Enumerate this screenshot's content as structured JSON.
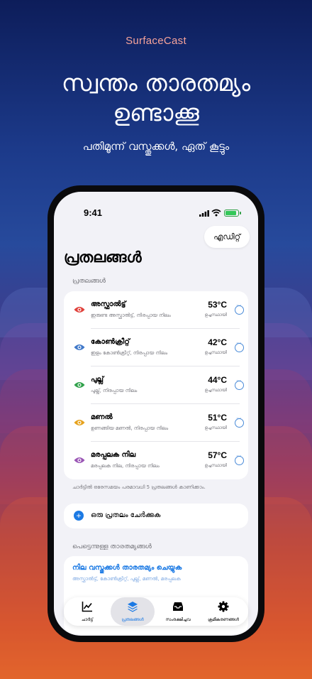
{
  "brand": "SurfaceCast",
  "headline": [
    "സ്വന്തം താരതമ്യം",
    "ഉണ്ടാക്കൂ"
  ],
  "subline": "പതിമൂന്ന് വസ്തുക്കൾ, ഏത് കൂട്ടും",
  "status_bar": {
    "time": "9:41",
    "battery_color": "#34c759"
  },
  "edit_label": "എഡിറ്റ്",
  "page_title": "പ്രതലങ്ങൾ",
  "surfaces_section_label": "പ്രതലങ്ങൾ",
  "surfaces": [
    {
      "name": "അസ്ഫാൽട്ട്",
      "desc": "ഇരുണ്ട അസ്ഫാൽട്ട്, നിരപ്പായ നിലം",
      "temp": "53°C",
      "state": "ഉച്ചസ്ഥായി",
      "color": "#e0403a"
    },
    {
      "name": "കോൺക്രീറ്റ്",
      "desc": "ഇളം കോൺക്രീറ്റ്, നിരപ്പായ നിലം",
      "temp": "42°C",
      "state": "ഉച്ചസ്ഥായി",
      "color": "#3f78c9"
    },
    {
      "name": "പുല്ല്",
      "desc": "പുല്ല്, നിരപ്പായ നിലം",
      "temp": "44°C",
      "state": "ഉച്ചസ്ഥായി",
      "color": "#2fa14a"
    },
    {
      "name": "മണൽ",
      "desc": "ഉണങ്ങിയ മണൽ, നിരപ്പായ നിലം",
      "temp": "51°C",
      "state": "ഉച്ചസ്ഥായി",
      "color": "#e6a21c"
    },
    {
      "name": "മരപ്പലക നില",
      "desc": "മരപ്പലക നില, നിരപ്പായ നിലം",
      "temp": "57°C",
      "state": "ഉച്ചസ്ഥായി",
      "color": "#9a55b5"
    }
  ],
  "chart_note": "ചാർട്ടിൽ ഒരേസമയം പരമാവധി 5 പ്രതലങ്ങൾ കാണിക്കാം.",
  "add_surface_label": "ഒരു പ്രതലം ചേർക്കുക",
  "quick_section_label": "പെട്ടെന്നുള്ള താരതമ്യങ്ങൾ",
  "quick_compare": {
    "title": "നില വസ്തുക്കൾ താരതമ്യം ചെയ്യുക",
    "subtitle": "അസ്ഫാൽട്ട്, കോൺക്രീറ്റ്, പുല്ല്, മണൽ, മരപ്പലക"
  },
  "tabs": [
    {
      "label": "ചാർട്ട്",
      "icon": "chart-icon"
    },
    {
      "label": "പ്രതലങ്ങൾ",
      "icon": "layers-icon",
      "active": true
    },
    {
      "label": "സംരക്ഷിച്ചവ",
      "icon": "tray-icon"
    },
    {
      "label": "ക്രമീകരണങ്ങൾ",
      "icon": "gear-icon"
    }
  ],
  "accent_color": "#1c7ae4"
}
